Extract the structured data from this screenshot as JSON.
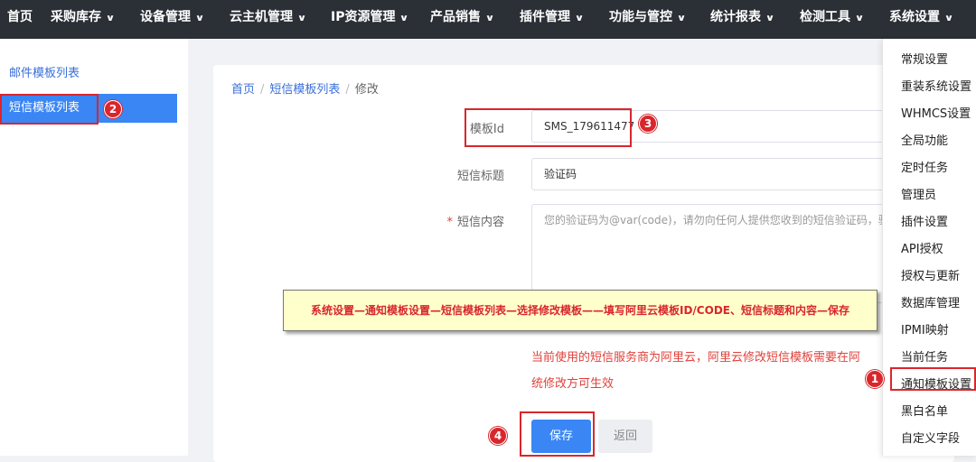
{
  "topnav": {
    "items": [
      {
        "label": "首页",
        "chevron": false
      },
      {
        "label": "采购库存",
        "chevron": true
      },
      {
        "label": "设备管理",
        "chevron": true
      },
      {
        "label": "云主机管理",
        "chevron": true
      },
      {
        "label": "IP资源管理",
        "chevron": true
      },
      {
        "label": "产品销售",
        "chevron": true
      },
      {
        "label": "插件管理",
        "chevron": true
      },
      {
        "label": "功能与管控",
        "chevron": true
      },
      {
        "label": "统计报表",
        "chevron": true
      },
      {
        "label": "检测工具",
        "chevron": true
      },
      {
        "label": "系统设置",
        "chevron": true
      }
    ],
    "chevron_glyph": "∨"
  },
  "sidebar": {
    "items": [
      {
        "label": "邮件模板列表",
        "active": false
      },
      {
        "label": "短信模板列表",
        "active": true
      }
    ]
  },
  "breadcrumb": {
    "home": "首页",
    "list": "短信模板列表",
    "current": "修改",
    "separator": "/"
  },
  "form": {
    "template_id_label": "模板Id",
    "template_id_value": "SMS_179611477",
    "title_label": "短信标题",
    "title_value": "验证码",
    "content_label": "短信内容",
    "content_required_mark": "*",
    "content_value": "您的验证码为@var(code)，请勿向任何人提供您收到的短信验证码，验",
    "hint_line1": "当前使用的短信服务商为阿里云，阿里云修改短信模板需要在阿",
    "hint_line2": "统修改方可生效"
  },
  "buttons": {
    "save": "保存",
    "back": "返回"
  },
  "dropdown": {
    "items": [
      "常规设置",
      "重装系统设置",
      "WHMCS设置",
      "全局功能",
      "定时任务",
      "管理员",
      "插件设置",
      "API授权",
      "授权与更新",
      "数据库管理",
      "IPMI映射",
      "当前任务",
      "通知模板设置",
      "黑白名单",
      "自定义字段"
    ]
  },
  "annotations": {
    "banner": "系统设置—通知模板设置—短信模板列表—选择修改模板——填写阿里云模板ID/CODE、短信标题和内容—保存",
    "badge1": "1",
    "badge2": "2",
    "badge3": "3",
    "badge4": "4",
    "color": "#d9262c"
  },
  "colors": {
    "nav_bg": "#2b2f36",
    "accent": "#3a86f5",
    "link": "#3a6fd8",
    "error": "#e0413b"
  }
}
